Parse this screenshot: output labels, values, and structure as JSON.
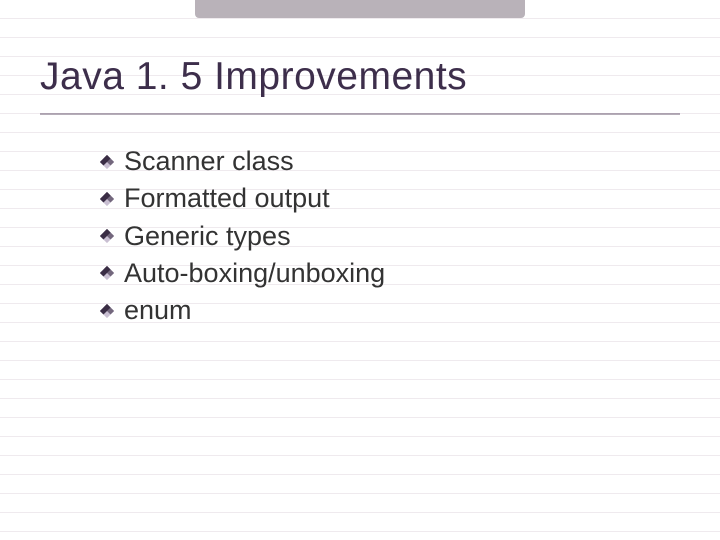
{
  "title": "Java 1. 5 Improvements",
  "items": [
    "Scanner class",
    "Formatted output",
    "Generic types",
    "Auto-boxing/unboxing",
    "enum"
  ],
  "bullet_icon": "diamond-bullet-icon",
  "colors": {
    "title": "#3d2e4b",
    "rule": "#5b4a62",
    "bullet_dark": "#3a2d45",
    "bullet_light": "#c9bfd2"
  }
}
